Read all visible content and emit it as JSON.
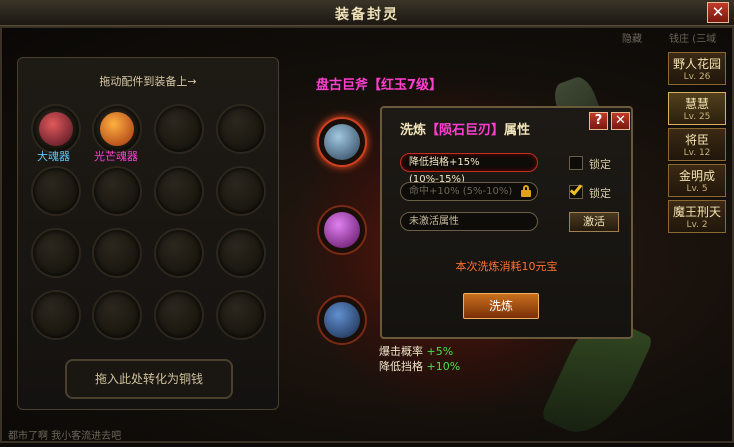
{
  "window": {
    "title": "装备封灵",
    "close_label": "✕"
  },
  "left_panel": {
    "hint": "拖动配件到装备上→",
    "slots": [
      {
        "label": "大魂器",
        "color": "#5cc8ff"
      },
      {
        "label": "光芒魂器",
        "color": "#ff3fd0"
      }
    ],
    "convert_label": "拖入此处转化为铜钱"
  },
  "equipment": {
    "name": "盘古巨斧【红玉7级】",
    "stats": [
      {
        "label": "爆击概率",
        "value": "+5%"
      },
      {
        "label": "降低挡格",
        "value": "+10%"
      }
    ]
  },
  "side_tabs": [
    {
      "name": "野人花园",
      "level": "Lv. 26"
    },
    {
      "name": "慧慧",
      "level": "Lv. 25"
    },
    {
      "name": "将臣",
      "level": "Lv. 12"
    },
    {
      "name": "金明成",
      "level": "Lv. 5"
    },
    {
      "name": "魔王刑天",
      "level": "Lv. 2"
    }
  ],
  "popup": {
    "title_prefix": "洗炼",
    "title_highlight": "【陨石巨刃】",
    "title_suffix": "属性",
    "help_label": "?",
    "close_label": "✕",
    "attributes": [
      {
        "text": "降低挡格+15% (10%-15%)",
        "lock_label": "锁定",
        "locked": false
      },
      {
        "text": "命中+10% (5%-10%)",
        "lock_label": "锁定",
        "locked": true
      },
      {
        "text": "未激活属性"
      }
    ],
    "activate_label": "激活",
    "cost_text": "本次洗炼消耗10元宝",
    "refine_label": "洗炼"
  },
  "background_text": {
    "top_left": "隐藏",
    "top_right": "钱庄 (三域",
    "bottom": "都市了啊  我小客流进去吧"
  },
  "colors": {
    "accent_magenta": "#ff3fd0",
    "stat_green": "#48e048",
    "cost_orange": "#ff7030"
  }
}
